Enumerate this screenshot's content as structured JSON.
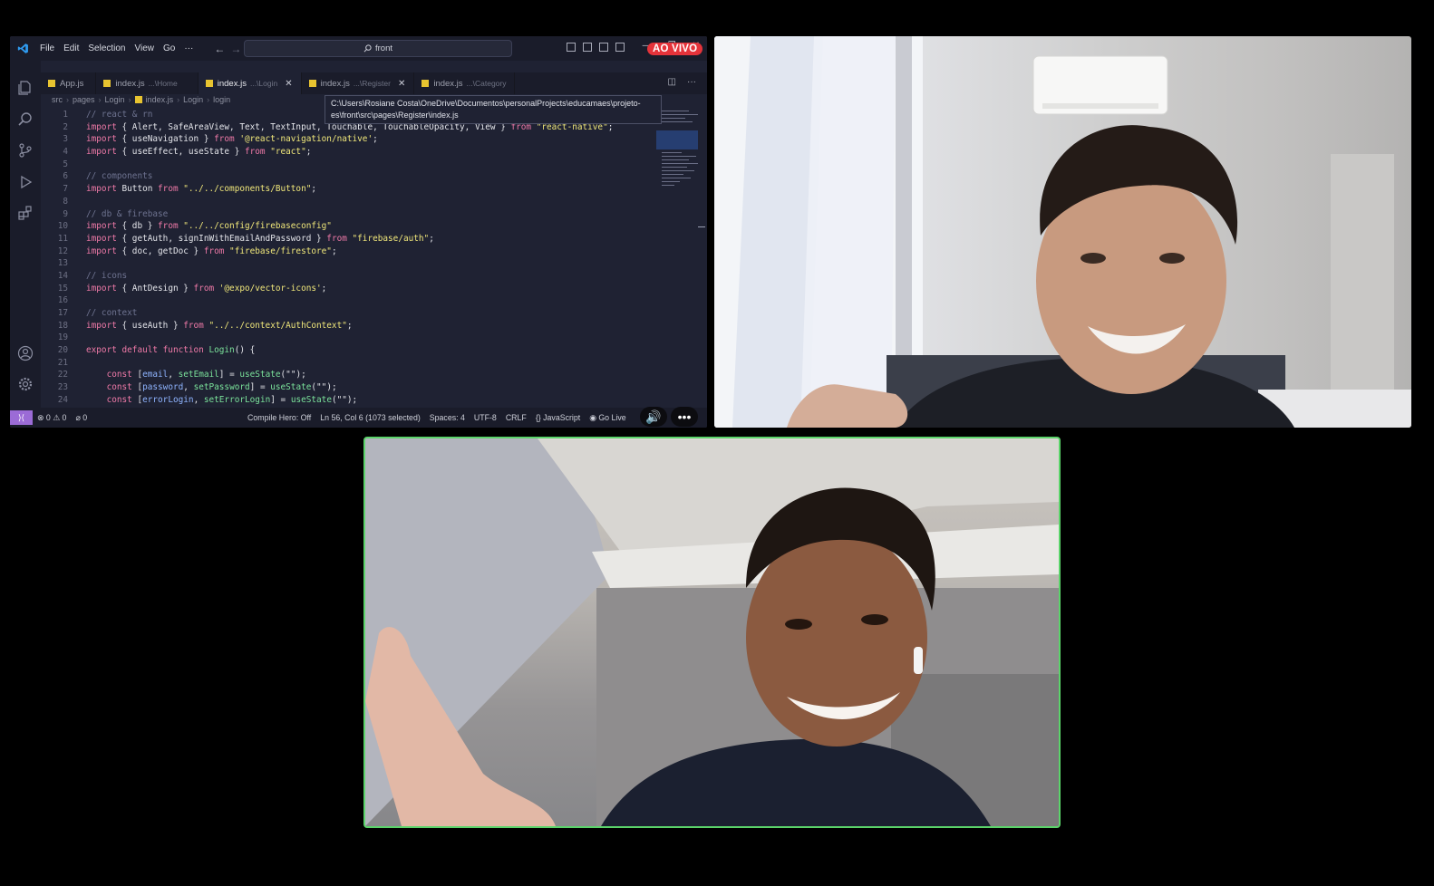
{
  "editor": {
    "menu": [
      "File",
      "Edit",
      "Selection",
      "View",
      "Go",
      "···"
    ],
    "command_center": "front",
    "live_badge": "AO VIVO",
    "tabs": [
      {
        "name": "App.js",
        "desc": "",
        "active": false
      },
      {
        "name": "index.js",
        "desc": "...\\Home",
        "active": false
      },
      {
        "name": "index.js",
        "desc": "...\\Login",
        "active": true
      },
      {
        "name": "index.js",
        "desc": "...\\Register",
        "active": false
      },
      {
        "name": "index.js",
        "desc": "...\\Category",
        "active": false
      }
    ],
    "breadcrumb": [
      "src",
      "pages",
      "Login",
      "index.js",
      "Login",
      "login"
    ],
    "tooltip": "C:\\Users\\Rosiane Costa\\OneDrive\\Documentos\\personalProjects\\educamaes\\projeto-es\\front\\src\\pages\\Register\\index.js",
    "status": {
      "errors": "0",
      "warnings": "0",
      "ports": "0",
      "compile_hero": "Compile Hero: Off",
      "cursor": "Ln 56, Col 6 (1073 selected)",
      "spaces": "Spaces: 4",
      "encoding": "UTF-8",
      "eol": "CRLF",
      "language": "JavaScript",
      "go_live": "Go Live"
    },
    "colors": {
      "accent": "#9b6bd6",
      "live": "#e5333a",
      "active_speaker": "#5bd46a"
    }
  },
  "code_lines": [
    {
      "n": "1",
      "t": [
        [
          "com",
          "// react & rn"
        ]
      ]
    },
    {
      "n": "2",
      "t": [
        [
          "kw",
          "import"
        ],
        [
          "plain",
          " { Alert, SafeAreaView, Text, TextInput, Touchable, TouchableOpacity, View } "
        ],
        [
          "kw",
          "from"
        ],
        [
          "str",
          " \"react-native\""
        ],
        [
          "plain",
          ";"
        ]
      ]
    },
    {
      "n": "3",
      "t": [
        [
          "kw",
          "import"
        ],
        [
          "plain",
          " { useNavigation } "
        ],
        [
          "kw",
          "from"
        ],
        [
          "str",
          " '@react-navigation/native'"
        ],
        [
          "plain",
          ";"
        ]
      ]
    },
    {
      "n": "4",
      "t": [
        [
          "kw",
          "import"
        ],
        [
          "plain",
          " { useEffect, useState } "
        ],
        [
          "kw",
          "from"
        ],
        [
          "str",
          " \"react\""
        ],
        [
          "plain",
          ";"
        ]
      ]
    },
    {
      "n": "5",
      "t": []
    },
    {
      "n": "6",
      "t": [
        [
          "com",
          "// components"
        ]
      ]
    },
    {
      "n": "7",
      "t": [
        [
          "kw",
          "import"
        ],
        [
          "plain",
          " Button "
        ],
        [
          "kw",
          "from"
        ],
        [
          "str",
          " \"../../components/Button\""
        ],
        [
          "plain",
          ";"
        ]
      ]
    },
    {
      "n": "8",
      "t": []
    },
    {
      "n": "9",
      "t": [
        [
          "com",
          "// db & firebase"
        ]
      ]
    },
    {
      "n": "10",
      "t": [
        [
          "kw",
          "import"
        ],
        [
          "plain",
          " { db } "
        ],
        [
          "kw",
          "from"
        ],
        [
          "str",
          " \"../../config/firebaseconfig\""
        ]
      ]
    },
    {
      "n": "11",
      "t": [
        [
          "kw",
          "import"
        ],
        [
          "plain",
          " { getAuth, signInWithEmailAndPassword } "
        ],
        [
          "kw",
          "from"
        ],
        [
          "str",
          " \"firebase/auth\""
        ],
        [
          "plain",
          ";"
        ]
      ]
    },
    {
      "n": "12",
      "t": [
        [
          "kw",
          "import"
        ],
        [
          "plain",
          " { doc, getDoc } "
        ],
        [
          "kw",
          "from"
        ],
        [
          "str",
          " \"firebase/firestore\""
        ],
        [
          "plain",
          ";"
        ]
      ]
    },
    {
      "n": "13",
      "t": []
    },
    {
      "n": "14",
      "t": [
        [
          "com",
          "// icons"
        ]
      ]
    },
    {
      "n": "15",
      "t": [
        [
          "kw",
          "import"
        ],
        [
          "plain",
          " { AntDesign } "
        ],
        [
          "kw",
          "from"
        ],
        [
          "str",
          " '@expo/vector-icons'"
        ],
        [
          "plain",
          ";"
        ]
      ]
    },
    {
      "n": "16",
      "t": []
    },
    {
      "n": "17",
      "t": [
        [
          "com",
          "// context"
        ]
      ]
    },
    {
      "n": "18",
      "t": [
        [
          "kw",
          "import"
        ],
        [
          "plain",
          " { useAuth } "
        ],
        [
          "kw",
          "from"
        ],
        [
          "str",
          " \"../../context/AuthContext\""
        ],
        [
          "plain",
          ";"
        ]
      ]
    },
    {
      "n": "19",
      "t": []
    },
    {
      "n": "20",
      "t": [
        [
          "kw",
          "export default function"
        ],
        [
          "fn",
          " Login"
        ],
        [
          "plain",
          "() {"
        ]
      ]
    },
    {
      "n": "21",
      "t": []
    },
    {
      "n": "22",
      "t": [
        [
          "plain",
          "    "
        ],
        [
          "kw",
          "const"
        ],
        [
          "plain",
          " ["
        ],
        [
          "var",
          "email"
        ],
        [
          "plain",
          ", "
        ],
        [
          "fn",
          "setEmail"
        ],
        [
          "plain",
          "] = "
        ],
        [
          "fn",
          "useState"
        ],
        [
          "plain",
          "(\"\");"
        ]
      ]
    },
    {
      "n": "23",
      "t": [
        [
          "plain",
          "    "
        ],
        [
          "kw",
          "const"
        ],
        [
          "plain",
          " ["
        ],
        [
          "var",
          "password"
        ],
        [
          "plain",
          ", "
        ],
        [
          "fn",
          "setPassword"
        ],
        [
          "plain",
          "] = "
        ],
        [
          "fn",
          "useState"
        ],
        [
          "plain",
          "(\"\");"
        ]
      ]
    },
    {
      "n": "24",
      "t": [
        [
          "plain",
          "    "
        ],
        [
          "kw",
          "const"
        ],
        [
          "plain",
          " ["
        ],
        [
          "var",
          "errorLogin"
        ],
        [
          "plain",
          ", "
        ],
        [
          "fn",
          "setErrorLogin"
        ],
        [
          "plain",
          "] = "
        ],
        [
          "fn",
          "useState"
        ],
        [
          "plain",
          "(\"\");"
        ]
      ]
    }
  ]
}
